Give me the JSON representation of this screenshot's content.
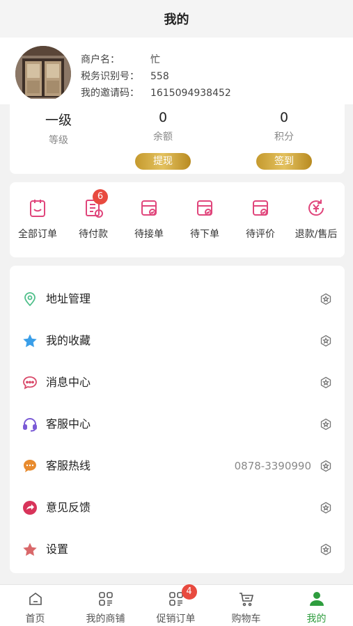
{
  "header": {
    "title": "我的"
  },
  "profile": {
    "merchant_label": "商户名：",
    "merchant_value": "忙",
    "tax_label": "税务识别号：",
    "tax_value": "558",
    "invite_label": "我的邀请码：",
    "invite_value": "1615094938452"
  },
  "stats": {
    "level_value": "一级",
    "level_label": "等级",
    "balance_value": "0",
    "balance_label": "余额",
    "points_value": "0",
    "points_label": "积分",
    "withdraw_button": "提现",
    "checkin_button": "签到"
  },
  "orders": [
    {
      "label": "全部订单",
      "icon": "clipboard-icon"
    },
    {
      "label": "待付款",
      "icon": "payment-icon",
      "badge": "6"
    },
    {
      "label": "待接单",
      "icon": "box-check-icon"
    },
    {
      "label": "待下单",
      "icon": "box-check-icon"
    },
    {
      "label": "待评价",
      "icon": "box-check-icon"
    },
    {
      "label": "退款/售后",
      "icon": "refund-icon"
    }
  ],
  "menu": [
    {
      "label": "地址管理",
      "icon": "location-pin-icon"
    },
    {
      "label": "我的收藏",
      "icon": "star-icon"
    },
    {
      "label": "消息中心",
      "icon": "chat-bubble-icon"
    },
    {
      "label": "客服中心",
      "icon": "headset-icon"
    },
    {
      "label": "客服热线",
      "icon": "hotline-icon",
      "extra": "0878-3390990"
    },
    {
      "label": "意见反馈",
      "icon": "feedback-icon"
    },
    {
      "label": "设置",
      "icon": "settings-star-icon"
    }
  ],
  "tabbar": [
    {
      "label": "首页",
      "icon": "home-icon"
    },
    {
      "label": "我的商铺",
      "icon": "store-grid-icon"
    },
    {
      "label": "促销订单",
      "icon": "promo-order-icon",
      "badge": "4"
    },
    {
      "label": "购物车",
      "icon": "cart-icon"
    },
    {
      "label": "我的",
      "icon": "user-icon",
      "active": true
    }
  ],
  "colors": {
    "accent_red": "#e84a3f",
    "order_icon_pink": "#e0457b",
    "gold": "#d4aa3c",
    "active_green": "#2e9d3e"
  }
}
